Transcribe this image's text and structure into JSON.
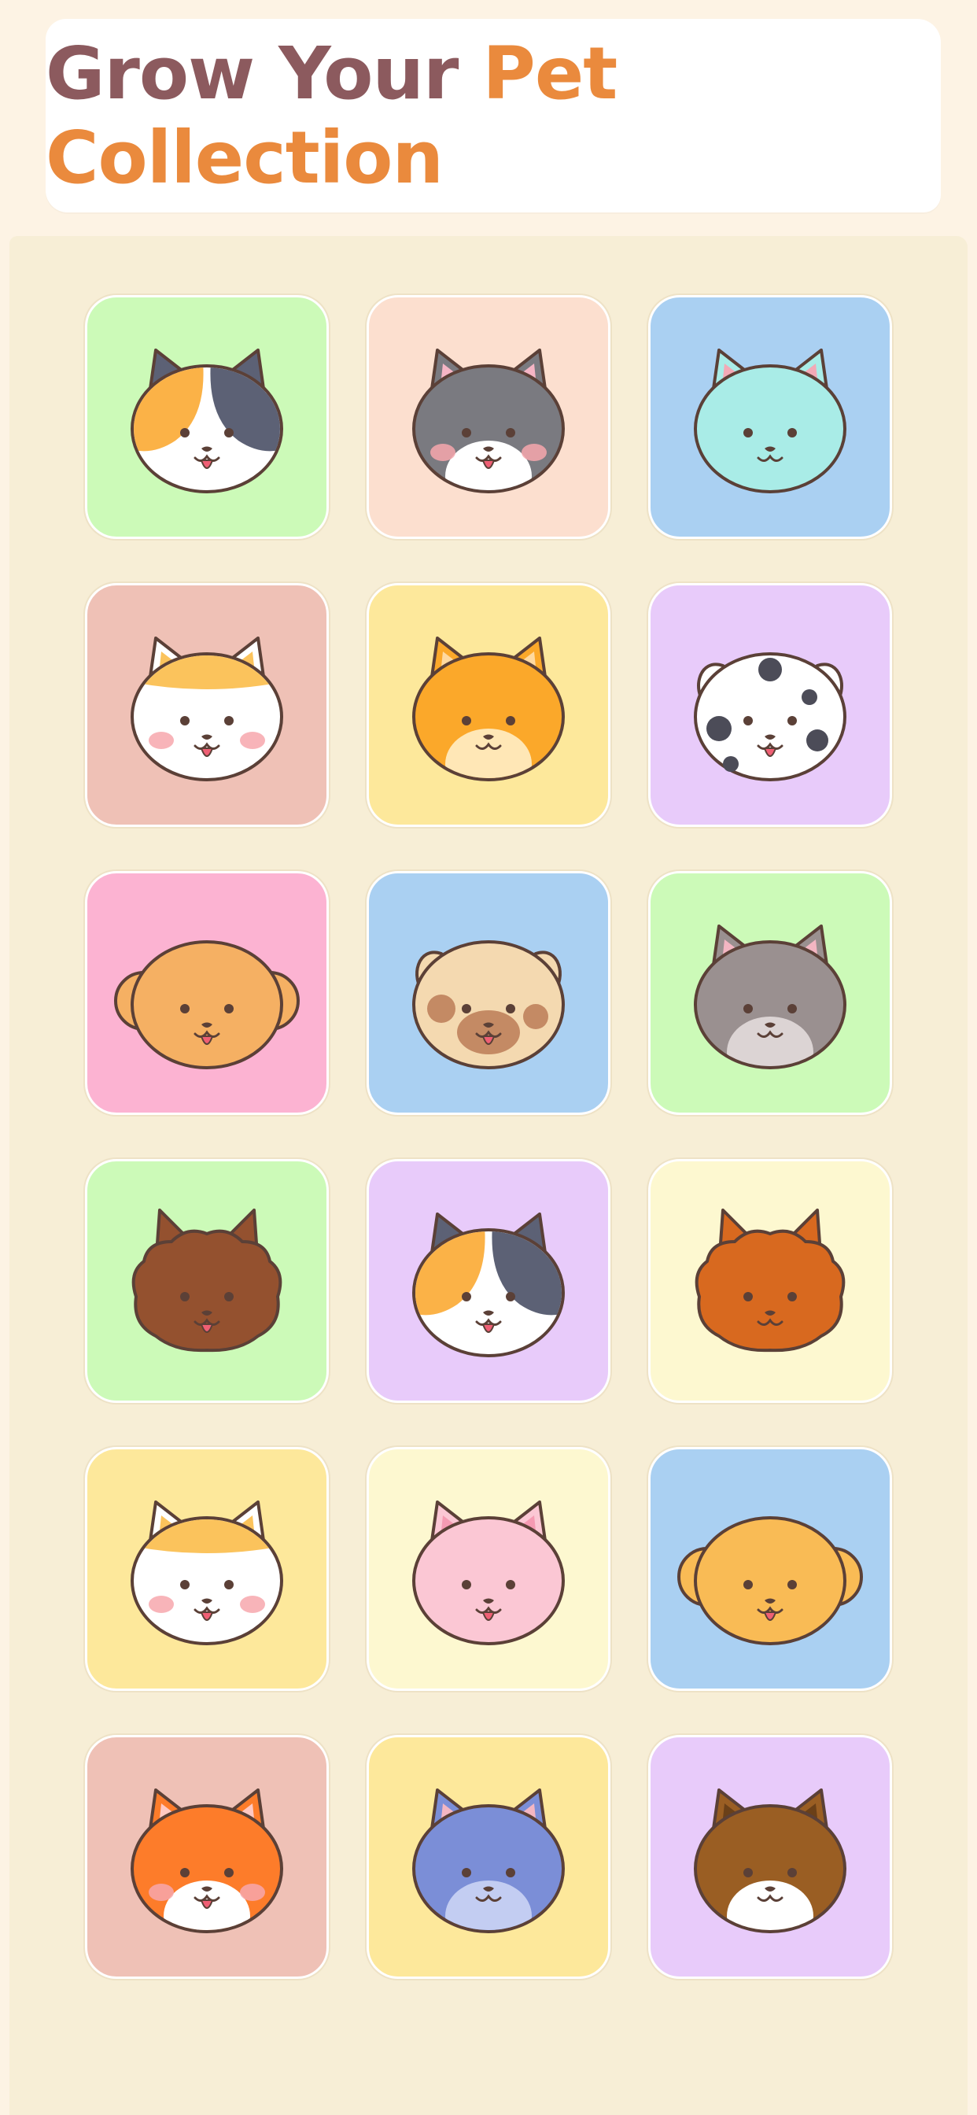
{
  "header": {
    "title_part1": "Grow Your ",
    "title_part2": "Pet Collection"
  },
  "colors": {
    "title_primary": "#8c5a5e",
    "title_accent": "#ea8a3d",
    "page_bg": "#fdf3e4",
    "board_bg": "#f7eed6"
  },
  "pets": [
    {
      "name": "calico-cat",
      "bg": "#ccfab8",
      "kind": "cat",
      "face": "#ffffff",
      "left": "#fbb247",
      "right": "#5c6175",
      "ear": "#5c6175",
      "inner": "#5c6175",
      "cheeks": false,
      "tongue": true
    },
    {
      "name": "gray-cat",
      "bg": "#fcdfcf",
      "kind": "cat",
      "face": "#7a7a80",
      "muzzle": "#ffffff",
      "ear": "#7a7a80",
      "inner": "#f5b5c5",
      "cheeks": true,
      "tongue": true
    },
    {
      "name": "mint-cat",
      "bg": "#aad0f2",
      "kind": "cat",
      "face": "#a9ece7",
      "ear": "#a9ece7",
      "inner": "#f3a9b6",
      "cheeks": false,
      "tongue": false
    },
    {
      "name": "white-orange-dog",
      "bg": "#efc1b6",
      "kind": "cat",
      "face": "#ffffff",
      "cap": "#fbc35c",
      "ear": "#ffffff",
      "inner": "#fbc35c",
      "cheeks": true,
      "tongue": true
    },
    {
      "name": "tabby-cat",
      "bg": "#fde89b",
      "kind": "cat",
      "face": "#fba82a",
      "muzzle": "#ffe7b6",
      "ear": "#fba82a",
      "inner": "#ffd9a0",
      "cheeks": false,
      "tongue": false
    },
    {
      "name": "dalmatian-dog",
      "bg": "#e8cbfa",
      "kind": "dog",
      "face": "#ffffff",
      "spots": true,
      "ear": "#ffffff",
      "cheeks": false,
      "tongue": true
    },
    {
      "name": "poodle",
      "bg": "#fcb3d2",
      "kind": "poodle",
      "face": "#f5b063",
      "cheeks": false,
      "tongue": true
    },
    {
      "name": "spotted-pup",
      "bg": "#aad0f2",
      "kind": "dog",
      "face": "#f4d9b0",
      "patch": "#c48a64",
      "ear": "#f4d9b0",
      "cheeks": false,
      "tongue": true
    },
    {
      "name": "gray-tabby",
      "bg": "#ccfab8",
      "kind": "cat",
      "face": "#9a9090",
      "muzzle": "#dcd4d4",
      "ear": "#9a9090",
      "inner": "#f3b6c2",
      "cheeks": false,
      "tongue": false
    },
    {
      "name": "terrier",
      "bg": "#ccfab8",
      "kind": "fluffy",
      "face": "#94512f",
      "ear": "#94512f",
      "cheeks": false,
      "tongue": true
    },
    {
      "name": "calico-cat-2",
      "bg": "#e8cbfa",
      "kind": "cat",
      "face": "#ffffff",
      "left": "#fbb247",
      "right": "#5c6175",
      "ear": "#5c6175",
      "inner": "#5c6175",
      "cheeks": false,
      "tongue": true
    },
    {
      "name": "pomeranian",
      "bg": "#fdf8d0",
      "kind": "fluffy",
      "face": "#d8691f",
      "ear": "#d8691f",
      "cheeks": false,
      "tongue": false
    },
    {
      "name": "white-orange-dog-2",
      "bg": "#fde89b",
      "kind": "cat",
      "face": "#ffffff",
      "cap": "#fbc35c",
      "ear": "#ffffff",
      "inner": "#fbc35c",
      "cheeks": true,
      "tongue": true
    },
    {
      "name": "pink-cat",
      "bg": "#fdf8d0",
      "kind": "cat",
      "face": "#fbc7d4",
      "ear": "#fbc7d4",
      "inner": "#f59ab2",
      "cheeks": false,
      "tongue": true
    },
    {
      "name": "poodle-2",
      "bg": "#aad0f2",
      "kind": "poodle",
      "face": "#f9bb55",
      "cheeks": false,
      "tongue": true
    },
    {
      "name": "fox",
      "bg": "#efc1b6",
      "kind": "cat",
      "face": "#fd7c2a",
      "muzzle": "#ffffff",
      "ear": "#fd7c2a",
      "inner": "#ffc9c3",
      "cheeks": true,
      "tongue": true
    },
    {
      "name": "blue-cat",
      "bg": "#fde89b",
      "kind": "cat",
      "face": "#7b8ed7",
      "muzzle": "#c3cdf2",
      "ear": "#7b8ed7",
      "inner": "#f3b6c2",
      "cheeks": false,
      "tongue": false
    },
    {
      "name": "brown-dog",
      "bg": "#e8cbfa",
      "kind": "cat",
      "face": "#9a5e23",
      "muzzle": "#ffffff",
      "ear": "#9a5e23",
      "inner": "#6b4018",
      "cheeks": false,
      "tongue": false
    }
  ]
}
